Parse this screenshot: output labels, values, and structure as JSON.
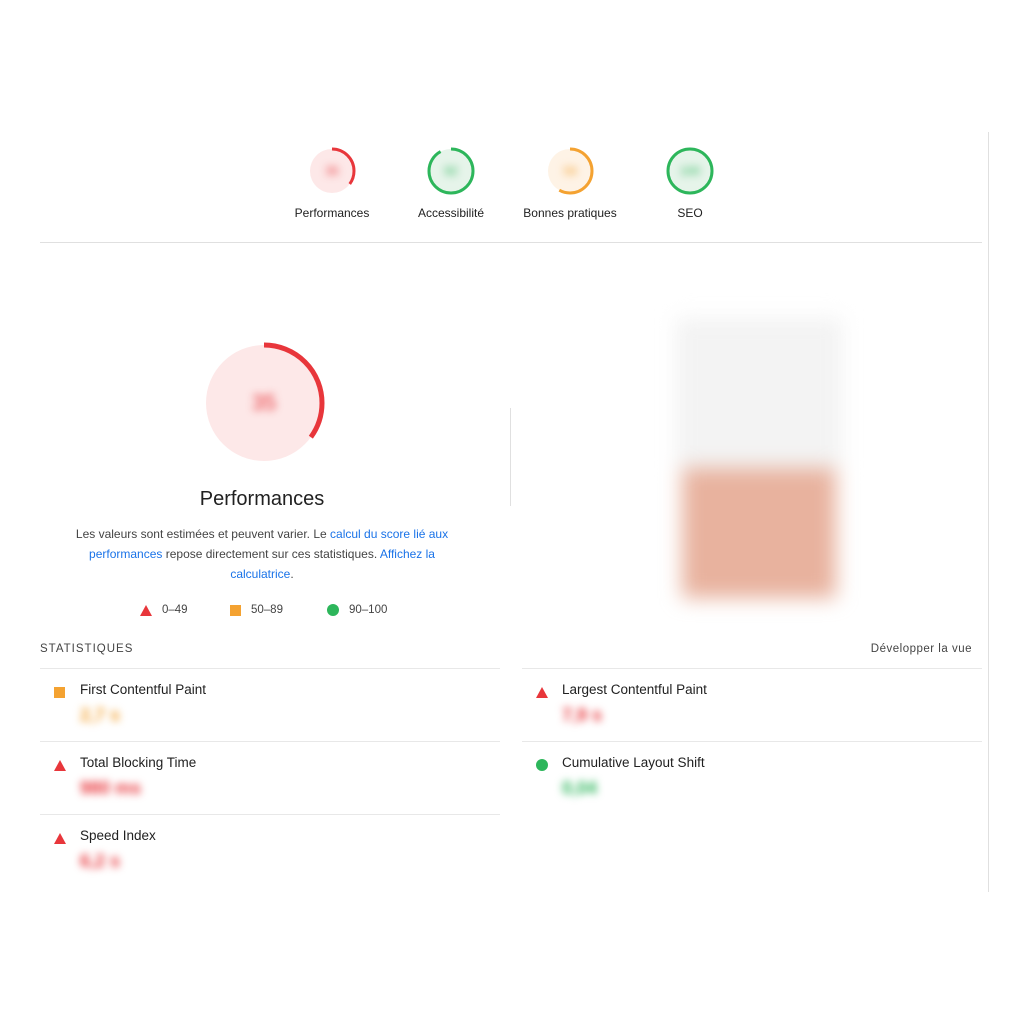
{
  "categories": [
    {
      "label": "Performances",
      "score": "35",
      "rating": "poor",
      "color": "#e8363b",
      "bg": "#fde8e8",
      "fraction": 0.35
    },
    {
      "label": "Accessibilité",
      "score": "92",
      "rating": "good",
      "color": "#2db65b",
      "bg": "#e6f4ea",
      "fraction": 0.92
    },
    {
      "label": "Bonnes pratiques",
      "score": "58",
      "rating": "average",
      "color": "#f4a231",
      "bg": "#fef3e6",
      "fraction": 0.58
    },
    {
      "label": "SEO",
      "score": "100",
      "rating": "good",
      "color": "#2db65b",
      "bg": "#e6f4ea",
      "fraction": 1.0
    }
  ],
  "main": {
    "title": "Performances",
    "score": "35",
    "desc_prefix": "Les valeurs sont estimées et peuvent varier. Le ",
    "link1": "calcul du score lié aux performances",
    "desc_mid": " repose directement sur ces statistiques. ",
    "link2": "Affichez la calculatrice",
    "desc_suffix": "."
  },
  "legend": [
    {
      "icon": "red-triangle-icon",
      "range": "0–49"
    },
    {
      "icon": "orange-square-icon",
      "range": "50–89"
    },
    {
      "icon": "green-circle-icon",
      "range": "90–100"
    }
  ],
  "stats": {
    "header": "STATISTIQUES",
    "expand": "Développer la vue",
    "metrics": [
      {
        "name": "First Contentful Paint",
        "value": "2,7 s",
        "rating": "average",
        "color": "#f4a231"
      },
      {
        "name": "Largest Contentful Paint",
        "value": "7,9 s",
        "rating": "poor",
        "color": "#e8363b"
      },
      {
        "name": "Total Blocking Time",
        "value": "980 ms",
        "rating": "poor",
        "color": "#e8363b"
      },
      {
        "name": "Cumulative Layout Shift",
        "value": "0,04",
        "rating": "good",
        "color": "#2db65b"
      },
      {
        "name": "Speed Index",
        "value": "6,2 s",
        "rating": "poor",
        "color": "#e8363b"
      }
    ]
  }
}
